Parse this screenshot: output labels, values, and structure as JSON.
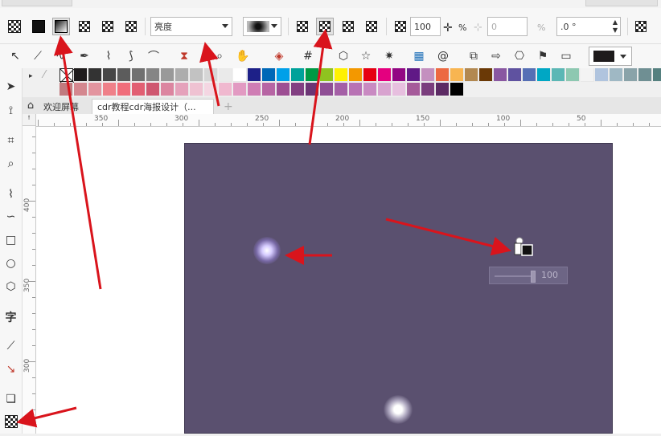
{
  "property_bar": {
    "mode_value": "亮度",
    "opacity_value": "100",
    "opacity_unit": "%",
    "feather_value": "0",
    "feather_unit": "%",
    "angle_value": ".0 °"
  },
  "tabs": [
    {
      "label": "欢迎屏幕"
    },
    {
      "label": "cdr教程cdr海报设计（..."
    },
    {
      "label": "+"
    }
  ],
  "ruler": {
    "h_ticks": [
      "350",
      "300",
      "250",
      "200",
      "150",
      "100",
      "50"
    ],
    "v_ticks": [
      "400",
      "350",
      "300"
    ]
  },
  "slider": {
    "value": "100"
  },
  "left_tools": {
    "text_tool": "字"
  },
  "palette": {
    "row1": [
      "#1e1b1c",
      "#333333",
      "#474747",
      "#5c5c5c",
      "#707070",
      "#858585",
      "#999999",
      "#adadad",
      "#c2c2c2",
      "#d6d6d6",
      "#eaeaea",
      "#ffffff",
      "#1d2088",
      "#0068b7",
      "#00a0e9",
      "#00a29a",
      "#009944",
      "#8fc31f",
      "#fff100",
      "#f39800",
      "#e60012",
      "#e4007f",
      "#920783",
      "#601986",
      "#c490bf",
      "#ec6941",
      "#f8b551",
      "#b28850",
      "#6a3906",
      "#8957a1",
      "#5f52a0",
      "#556fb5",
      "#00a7c4",
      "#5bb7b5",
      "#8dc8b1",
      "#f3f3f3",
      "#b0c4de",
      "#9fb8c4",
      "#8aa3a9",
      "#6f8f93",
      "#55807f",
      "#4a7b6f",
      "#3f7563",
      "#66a08a",
      "#80b6a0",
      "#99c8b4",
      "#a3c0b8",
      "#b5d3cc"
    ],
    "row2": [
      "#c17a7f",
      "#d4878f",
      "#e3949f",
      "#ef8089",
      "#f06d7b",
      "#e25f73",
      "#cf5770",
      "#dc85a0",
      "#e5a2bb",
      "#efc2d2",
      "#f4d6e2",
      "#f0b8cf",
      "#e29ac2",
      "#cf7db4",
      "#b765a4",
      "#9d4e93",
      "#823f82",
      "#6c3575",
      "#8f4e95",
      "#a45fa6",
      "#b872b4",
      "#c98ac2",
      "#d8a3cf",
      "#e7bfdf",
      "#a55a9a",
      "#7a3d7d",
      "#5c2a64",
      "#000000"
    ],
    "colors_note": "accent"
  },
  "colors": {
    "poster_bg": "#5a506f",
    "arrow_red": "#d9141c",
    "glow": "#e6e0ff"
  }
}
